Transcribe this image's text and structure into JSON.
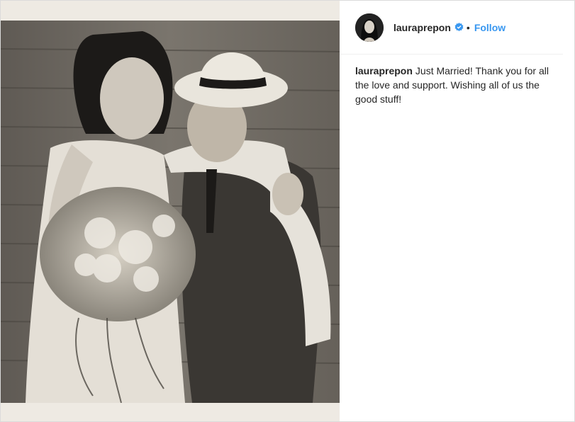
{
  "post": {
    "username": "lauraprepon",
    "verified_icon": "verified-badge-icon",
    "separator": "•",
    "follow_label": "Follow",
    "caption_user": "lauraprepon",
    "caption_text": "Just Married! Thank you for all the love and support. Wishing all of us the good stuff!"
  },
  "colors": {
    "follow": "#3897f0",
    "text": "#262626",
    "divider": "#efefef"
  }
}
